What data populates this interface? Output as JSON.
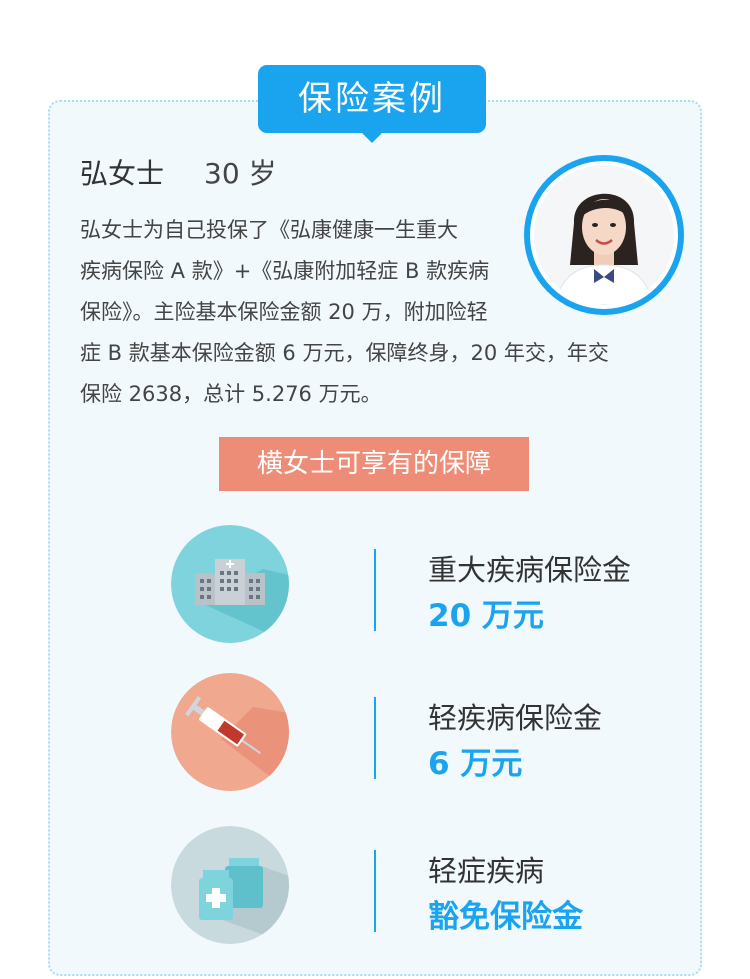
{
  "header": {
    "title": "保险案例"
  },
  "profile": {
    "name": "弘女士",
    "age": "30 岁",
    "description": "弘女士为自己投保了《弘康健康一生重大疾病保险 A 款》+《弘康附加轻症 B 款疾病保险》。主险基本保险金额 20 万，附加险轻症 B 款基本保险金额 6 万元，保障终身，20 年交，年交保险 2638，总计 5.276 万元。",
    "desc_lines": [
      "弘女士为自己投保了《弘康健康一生重大",
      "疾病保险 A 款》+《弘康附加轻症 B 款疾病",
      "保险》。主险基本保险金额 20 万，附加险轻",
      "症 B 款基本保险金额 6 万元，保障终身，20 年交，年交",
      "保险 2638，总计 5.276 万元。"
    ]
  },
  "subtitle": "横女士可享有的保障",
  "benefits": [
    {
      "icon": "hospital-icon",
      "label": "重大疾病保险金",
      "value": "20 万元",
      "circle_color": "#7fd3dc"
    },
    {
      "icon": "syringe-icon",
      "label": "轻疾病保险金",
      "value": "6 万元",
      "circle_color": "#f0a88f"
    },
    {
      "icon": "medicine-bottles-icon",
      "label": "轻症疾病",
      "value": "豁免保险金",
      "circle_color": "#c8dadd"
    }
  ],
  "colors": {
    "accent": "#1aa3ee",
    "banner": "#ed8d77",
    "card_bg": "#f1f9fd"
  }
}
